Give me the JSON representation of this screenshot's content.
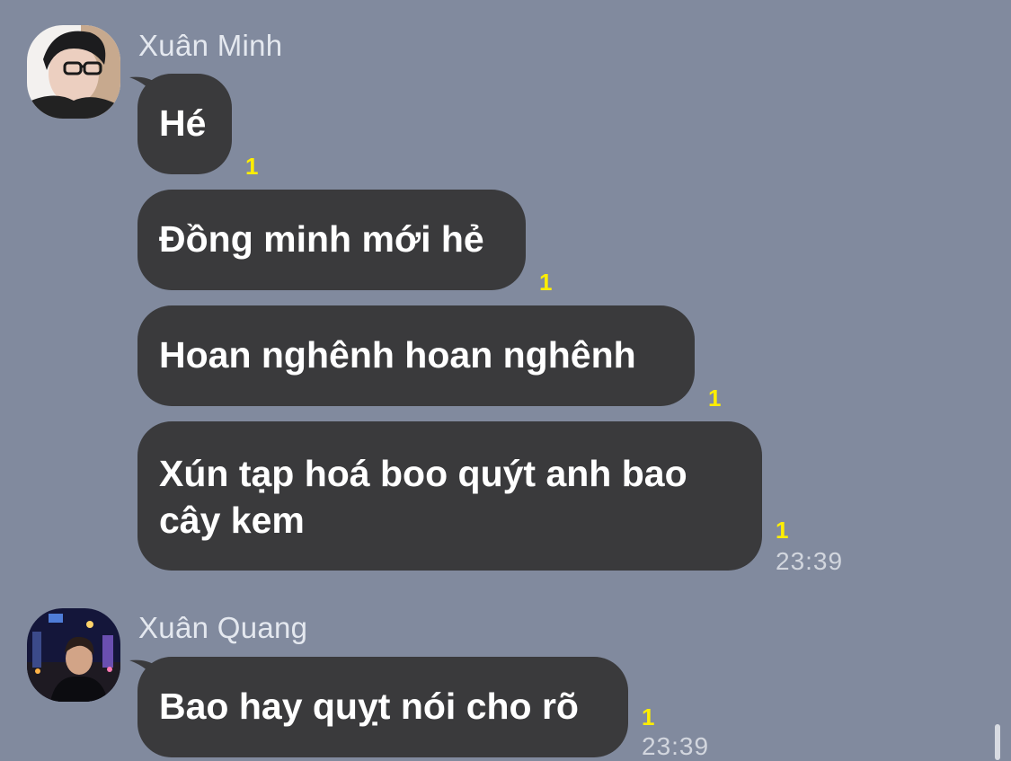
{
  "chat": {
    "groups": [
      {
        "sender": "Xuân Minh",
        "avatar_icon": "profile-photo-glasses-icon",
        "messages": [
          {
            "text": "Hé",
            "unread": "1"
          },
          {
            "text": "Đồng minh mới hẻ",
            "unread": "1"
          },
          {
            "text": "Hoan nghênh hoan nghênh",
            "unread": "1"
          },
          {
            "text": "Xún tạp hoá boo quýt anh bao cây kem",
            "unread": "1",
            "time": "23:39"
          }
        ]
      },
      {
        "sender": "Xuân Quang",
        "avatar_icon": "profile-photo-night-city-icon",
        "messages": [
          {
            "text": "Bao hay quỵt nói cho rõ",
            "unread": "1",
            "time": "23:39"
          }
        ]
      }
    ]
  },
  "colors": {
    "background": "#818a9e",
    "bubble": "#3a3a3c",
    "bubble_text": "#ffffff",
    "unread": "#ffee00",
    "timestamp": "#d2d6de"
  }
}
